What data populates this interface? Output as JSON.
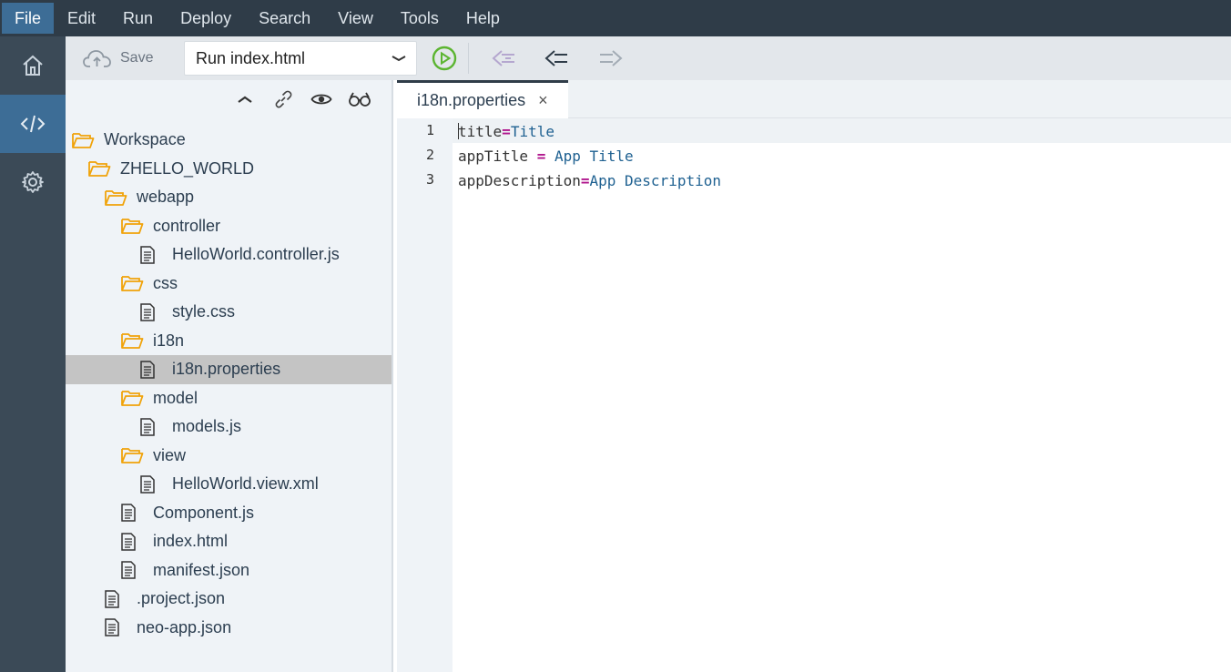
{
  "menu": {
    "items": [
      "File",
      "Edit",
      "Run",
      "Deploy",
      "Search",
      "View",
      "Tools",
      "Help"
    ],
    "active": "File"
  },
  "rail": {
    "items": [
      {
        "icon": "home-icon",
        "active": false
      },
      {
        "icon": "code-icon",
        "active": true
      },
      {
        "icon": "gear-icon",
        "active": false
      }
    ]
  },
  "toolbar": {
    "save_label": "Save",
    "run_config": "Run index.html"
  },
  "tree": {
    "items": [
      {
        "label": "Workspace",
        "type": "folder",
        "depth": 0
      },
      {
        "label": "ZHELLO_WORLD",
        "type": "folder",
        "depth": 1
      },
      {
        "label": "webapp",
        "type": "folder",
        "depth": 2
      },
      {
        "label": "controller",
        "type": "folder",
        "depth": 3
      },
      {
        "label": "HelloWorld.controller.js",
        "type": "file",
        "depth": 4
      },
      {
        "label": "css",
        "type": "folder",
        "depth": 3
      },
      {
        "label": "style.css",
        "type": "file",
        "depth": 4
      },
      {
        "label": "i18n",
        "type": "folder",
        "depth": 3
      },
      {
        "label": "i18n.properties",
        "type": "file",
        "depth": 4,
        "selected": true
      },
      {
        "label": "model",
        "type": "folder",
        "depth": 3
      },
      {
        "label": "models.js",
        "type": "file",
        "depth": 4
      },
      {
        "label": "view",
        "type": "folder",
        "depth": 3
      },
      {
        "label": "HelloWorld.view.xml",
        "type": "file",
        "depth": 4
      },
      {
        "label": "Component.js",
        "type": "file",
        "depth": 3
      },
      {
        "label": "index.html",
        "type": "file",
        "depth": 3
      },
      {
        "label": "manifest.json",
        "type": "file",
        "depth": 3
      },
      {
        "label": ".project.json",
        "type": "file",
        "depth": 2
      },
      {
        "label": "neo-app.json",
        "type": "file",
        "depth": 2
      }
    ]
  },
  "editor": {
    "tab_label": "i18n.properties",
    "tab_close": "×",
    "lines": [
      {
        "num": "1",
        "key": "title",
        "op": "=",
        "value": "Title"
      },
      {
        "num": "2",
        "key": "appTitle ",
        "op": "=",
        "value": " App Title"
      },
      {
        "num": "3",
        "key": "appDescription",
        "op": "=",
        "value": "App Description"
      }
    ]
  },
  "colors": {
    "menubar": "#2f3c48",
    "accent": "#3d6d96",
    "folder": "#f0a30a",
    "run_green": "#5cb531"
  }
}
